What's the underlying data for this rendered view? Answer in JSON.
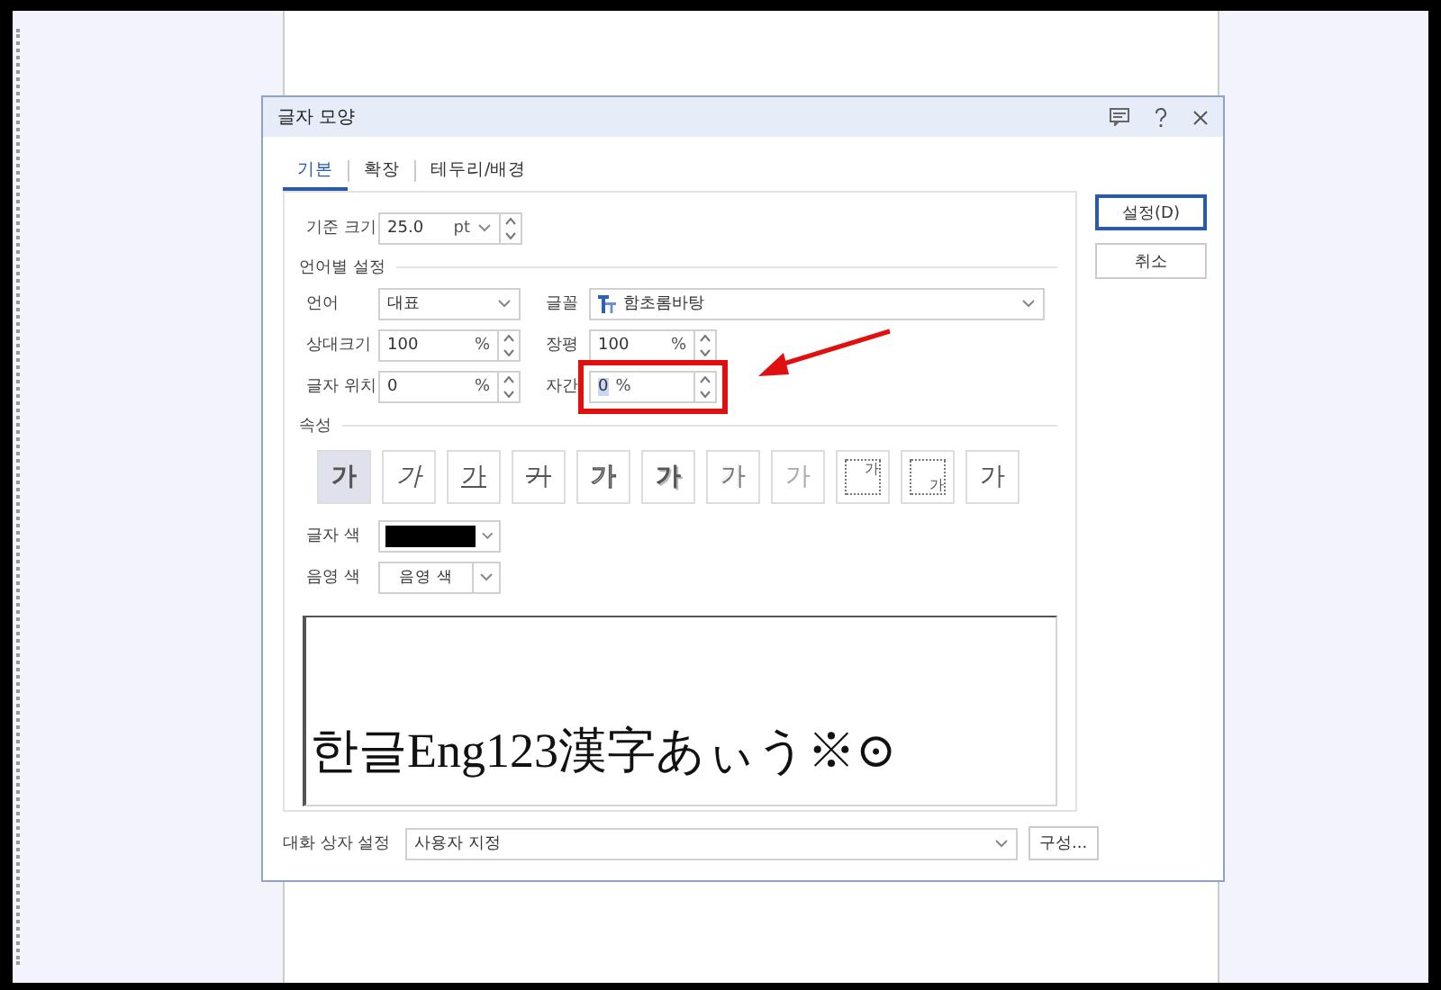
{
  "window": {
    "title": "글자 모양"
  },
  "tabs": [
    {
      "label": "기본",
      "selected": true
    },
    {
      "label": "확장",
      "selected": false
    },
    {
      "label": "테두리/배경",
      "selected": false
    }
  ],
  "base_size": {
    "label": "기준 크기",
    "value": "25.0",
    "unit": "pt"
  },
  "language_section": {
    "title": "언어별 설정",
    "language": {
      "label": "언어",
      "value": "대표"
    },
    "font": {
      "label": "글꼴",
      "value": "함초롬바탕"
    },
    "fields": [
      {
        "label": "상대크기",
        "value": "100",
        "unit": "%",
        "highlighted": false
      },
      {
        "label": "장평",
        "value": "100",
        "unit": "%",
        "highlighted": false
      },
      {
        "label": "글자 위치",
        "value": "0",
        "unit": "%",
        "highlighted": false
      },
      {
        "label": "자간",
        "value": "0",
        "unit": "%",
        "highlighted": true
      }
    ]
  },
  "attributes": {
    "title": "속성",
    "buttons": [
      {
        "kind": "bold",
        "label": "가",
        "selected": true
      },
      {
        "kind": "italic",
        "label": "가",
        "selected": false
      },
      {
        "kind": "underline",
        "label": "가",
        "selected": false
      },
      {
        "kind": "strike",
        "label": "가",
        "selected": false
      },
      {
        "kind": "outline",
        "label": "가",
        "selected": false
      },
      {
        "kind": "shadow",
        "label": "가",
        "selected": false
      },
      {
        "kind": "emboss",
        "label": "가",
        "selected": false
      },
      {
        "kind": "engrave",
        "label": "가",
        "selected": false
      },
      {
        "kind": "superscript",
        "label": "가",
        "selected": false
      },
      {
        "kind": "subscript",
        "label": "가",
        "selected": false
      },
      {
        "kind": "normal",
        "label": "가",
        "selected": false
      }
    ]
  },
  "text_color": {
    "label": "글자 색",
    "color": "#000000"
  },
  "shade_color": {
    "label": "음영 색",
    "value": "음영 색"
  },
  "preview": {
    "text": "한글Eng123漢字あぃう※⊙"
  },
  "dialog_setting": {
    "label": "대화 상자 설정",
    "value": "사용자 지정",
    "button": "구성..."
  },
  "buttons": [
    {
      "label": "설정(D)",
      "kind": "primary"
    },
    {
      "label": "취소",
      "kind": "normal"
    }
  ]
}
